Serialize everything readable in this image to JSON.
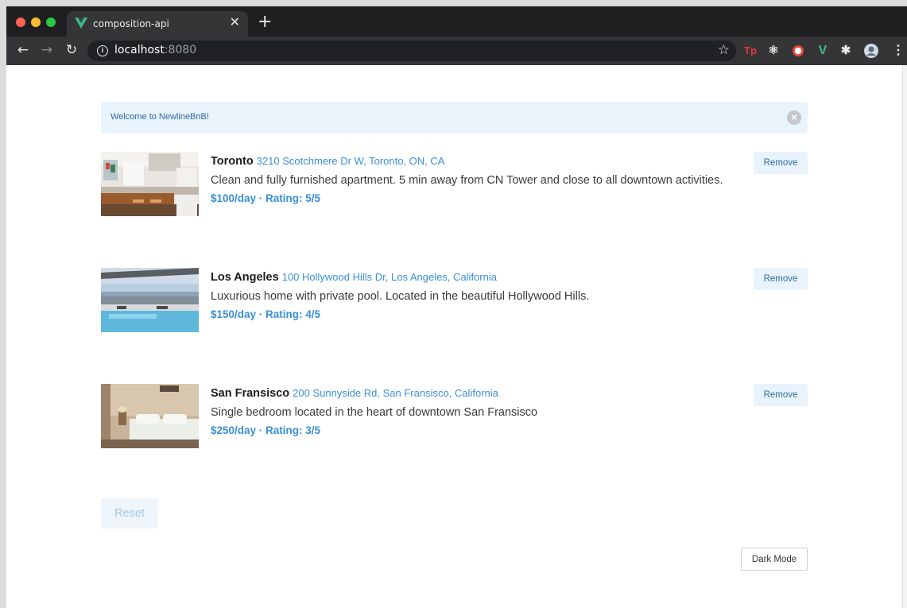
{
  "browser": {
    "tab_title": "composition-api",
    "url_host": "localhost",
    "url_port": ":8080",
    "extensions": [
      "tp-extension-icon",
      "react-devtools-icon",
      "record-icon",
      "vue-devtools-icon",
      "extensions-puzzle-icon",
      "profile-avatar-icon"
    ]
  },
  "alert": {
    "text": "Welcome to NewlineBnB!"
  },
  "listings": [
    {
      "city": "Toronto",
      "address": "3210 Scotchmere Dr W, Toronto, ON, CA",
      "description": "Clean and fully furnished apartment. 5 min away from CN Tower and close to all downtown activities.",
      "meta": "$100/day · Rating: 5/5",
      "remove_label": "Remove",
      "image": "kitchen-photo"
    },
    {
      "city": "Los Angeles",
      "address": "100 Hollywood Hills Dr, Los Angeles, California",
      "description": "Luxurious home with private pool. Located in the beautiful Hollywood Hills.",
      "meta": "$150/day · Rating: 4/5",
      "remove_label": "Remove",
      "image": "pool-photo"
    },
    {
      "city": "San Fransisco",
      "address": "200 Sunnyside Rd, San Fransisco, California",
      "description": "Single bedroom located in the heart of downtown San Fransisco",
      "meta": "$250/day · Rating: 3/5",
      "remove_label": "Remove",
      "image": "bedroom-photo"
    }
  ],
  "reset_label": "Reset",
  "dark_mode_label": "Dark Mode",
  "colors": {
    "accent": "#3a8fd6",
    "alert_bg": "#e9f3fb",
    "chrome_dark": "#1f1f21"
  }
}
